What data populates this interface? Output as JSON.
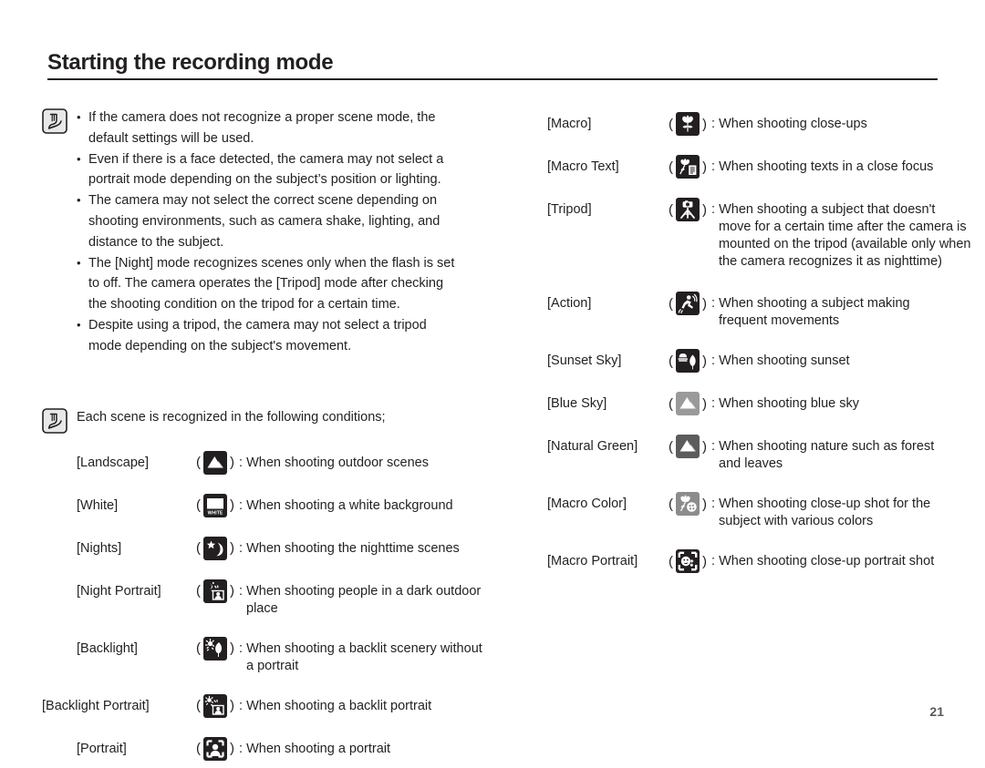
{
  "header": {
    "title": "Starting the recording mode"
  },
  "page_number": "21",
  "note1": {
    "icon": "note-pen-icon",
    "bullets": [
      [
        "If the camera does not recognize a proper scene mode, the",
        "default settings will be used."
      ],
      [
        "Even if there is a face detected, the camera may not select a",
        "portrait mode depending on the subject’s position or lighting."
      ],
      [
        "The camera may not select the correct scene depending on",
        "shooting environments, such as camera shake, lighting, and",
        "distance to the subject."
      ],
      [
        "The [Night] mode recognizes scenes only when the flash is set",
        "to off. The camera operates the [Tripod] mode after checking",
        "the shooting condition on the tripod for a certain time."
      ],
      [
        "Despite using a tripod, the camera may not select a tripod",
        "mode depending on the subject's movement."
      ]
    ]
  },
  "note2": {
    "icon": "note-pen-icon",
    "intro": "Each scene is recognized in the following conditions;"
  },
  "left_scenes": [
    {
      "name": "[Landscape]",
      "icon": "landscape-icon",
      "icon_bg": "#231f20",
      "desc": [
        "When shooting outdoor scenes"
      ]
    },
    {
      "name": "[White]",
      "icon": "white-background-icon",
      "icon_bg": "#231f20",
      "desc": [
        "When shooting a white background"
      ]
    },
    {
      "name": "[Nights]",
      "icon": "night-moon-star-icon",
      "icon_bg": "#231f20",
      "desc": [
        "When shooting the nighttime scenes"
      ]
    },
    {
      "name": "[Night Portrait]",
      "icon": "night-portrait-icon",
      "icon_bg": "#231f20",
      "desc": [
        "When shooting people in a dark outdoor",
        "place"
      ]
    },
    {
      "name": "[Backlight]",
      "icon": "backlight-icon",
      "icon_bg": "#231f20",
      "desc": [
        "When shooting a backlit scenery without",
        "a portrait"
      ]
    },
    {
      "name": "[Backlight Portrait]",
      "icon": "backlight-portrait-icon",
      "icon_bg": "#231f20",
      "desc": [
        "When shooting a backlit portrait"
      ]
    },
    {
      "name": "[Portrait]",
      "icon": "portrait-icon",
      "icon_bg": "#231f20",
      "desc": [
        "When shooting a portrait"
      ]
    }
  ],
  "right_scenes": [
    {
      "name": "[Macro]",
      "icon": "macro-flower-icon",
      "icon_bg": "#231f20",
      "desc": [
        "When shooting close-ups"
      ]
    },
    {
      "name": "[Macro Text]",
      "icon": "macro-text-icon",
      "icon_bg": "#231f20",
      "desc": [
        "When shooting texts in a close focus"
      ]
    },
    {
      "name": "[Tripod]",
      "icon": "tripod-icon",
      "icon_bg": "#231f20",
      "desc": [
        "When shooting a subject that doesn't",
        "move for a certain time after the camera is",
        "mounted on the tripod (available only when",
        "the camera recognizes it as nighttime)"
      ]
    },
    {
      "name": "[Action]",
      "icon": "action-runner-icon",
      "icon_bg": "#231f20",
      "desc": [
        "When shooting a subject making",
        "frequent movements"
      ]
    },
    {
      "name": "[Sunset Sky]",
      "icon": "sunset-sky-icon",
      "icon_bg": "#231f20",
      "desc": [
        "When shooting sunset"
      ]
    },
    {
      "name": "[Blue Sky]",
      "icon": "blue-sky-icon",
      "icon_bg": "#9a9a9a",
      "desc": [
        "When shooting blue sky"
      ]
    },
    {
      "name": "[Natural Green]",
      "icon": "natural-green-icon",
      "icon_bg": "#5c5c5c",
      "desc": [
        "When shooting nature such as forest",
        "and leaves"
      ]
    },
    {
      "name": "[Macro Color]",
      "icon": "macro-color-icon",
      "icon_bg": "#8c8c8c",
      "desc": [
        "When shooting close-up shot for the",
        "subject with various colors"
      ]
    },
    {
      "name": "[Macro Portrait]",
      "icon": "macro-portrait-icon",
      "icon_bg": "#231f20",
      "desc": [
        "When shooting close-up portrait shot"
      ]
    }
  ],
  "symbols": {
    "open_paren": "(",
    "close_paren": ")",
    "colon": ":"
  },
  "colors": {
    "text": "#231f20",
    "icon_dark": "#231f20",
    "icon_gray_light": "#9a9a9a",
    "icon_gray_mid": "#5c5c5c",
    "page_number": "#58595b"
  }
}
